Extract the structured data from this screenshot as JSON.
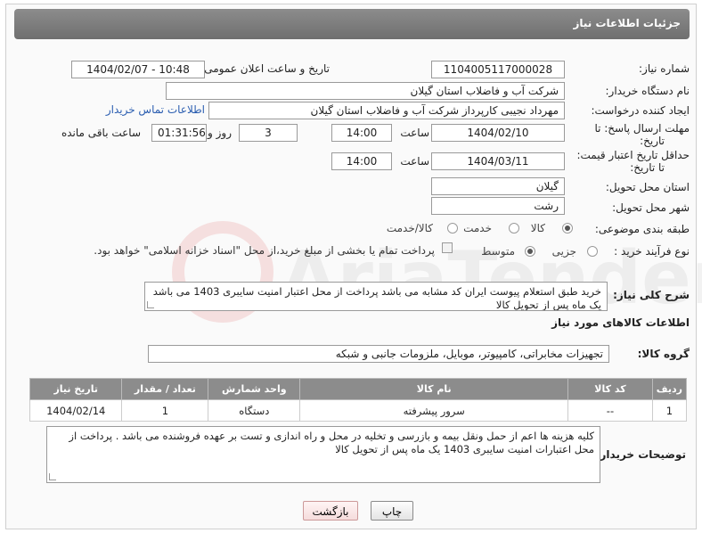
{
  "header": {
    "title": "جزئیات اطلاعات نیاز"
  },
  "form": {
    "need_number_label": "شماره نیاز:",
    "need_number": "1104005117000028",
    "announce_label": "تاریخ و ساعت اعلان عمومی:",
    "announce_value": "1404/02/07 - 10:48",
    "buyer_label": "نام دستگاه خریدار:",
    "buyer_value": "شرکت آب و فاضلاب استان گیلان",
    "creator_label": "ایجاد کننده درخواست:",
    "creator_value": "مهرداد نجیبی کارپرداز شرکت آب و فاضلاب استان گیلان",
    "contact_link": "اطلاعات تماس خریدار",
    "deadline_label_1": "مهلت ارسال پاسخ: تا",
    "deadline_label_2": "تاریخ:",
    "deadline_date": "1404/02/10",
    "time_label": "ساعت",
    "deadline_time": "14:00",
    "days_value": "3",
    "days_label": "روز و",
    "remaining_time": "01:31:56",
    "remaining_label": "ساعت باقی مانده",
    "validity_label_1": "حداقل تاریخ اعتبار قیمت:",
    "validity_label_2": "تا تاریخ:",
    "validity_date": "1404/03/11",
    "validity_time": "14:00",
    "province_label": "استان محل تحویل:",
    "province_value": "گیلان",
    "city_label": "شهر محل تحویل:",
    "city_value": "رشت",
    "category_label": "طبقه بندی موضوعی:",
    "category_options": [
      "کالا",
      "خدمت",
      "کالا/خدمت"
    ],
    "process_label": "نوع فرآیند خرید :",
    "process_options": [
      "جزیی",
      "متوسط"
    ],
    "payment_note": "پرداخت تمام یا بخشی از مبلغ خرید،از محل \"اسناد خزانه اسلامی\" خواهد بود."
  },
  "description": {
    "label": "شرح کلی نیاز:",
    "text": "خرید طبق استعلام پیوست ایران کد  مشابه می باشد پرداخت از محل اعتبار امنیت سایبری 1403  می باشد یک ماه پس از تحویل کالا"
  },
  "goods": {
    "section_title": "اطلاعات کالاهای مورد نیاز",
    "group_label": "گروه کالا:",
    "group_value": "تجهیزات مخابراتی، کامپیوتر، موبایل، ملزومات جانبی و شبکه",
    "columns": [
      "ردیف",
      "کد کالا",
      "نام کالا",
      "واحد شمارش",
      "تعداد / مقدار",
      "تاریخ نیاز"
    ],
    "rows": [
      {
        "index": "1",
        "code": "--",
        "name": "سرور پیشرفته",
        "unit": "دستگاه",
        "qty": "1",
        "date": "1404/02/14"
      }
    ]
  },
  "buyer_notes": {
    "label": "توضیحات خریدار:",
    "text": "کلیه هزینه ها  اعم از حمل ونقل بیمه و بازرسی و تخلیه در محل و راه اندازی و تست بر عهده فروشنده می باشد . پرداخت از محل اعتبارات امنیت سایبری 1403 یک ماه پس از تحویل کالا"
  },
  "buttons": {
    "print": "چاپ",
    "back": "بازگشت"
  },
  "watermark": {
    "text": "AriaTender.neT"
  },
  "colors": {
    "header": "#7d7d7d",
    "link": "#2a5db0",
    "table_header": "#8c8c8c"
  }
}
